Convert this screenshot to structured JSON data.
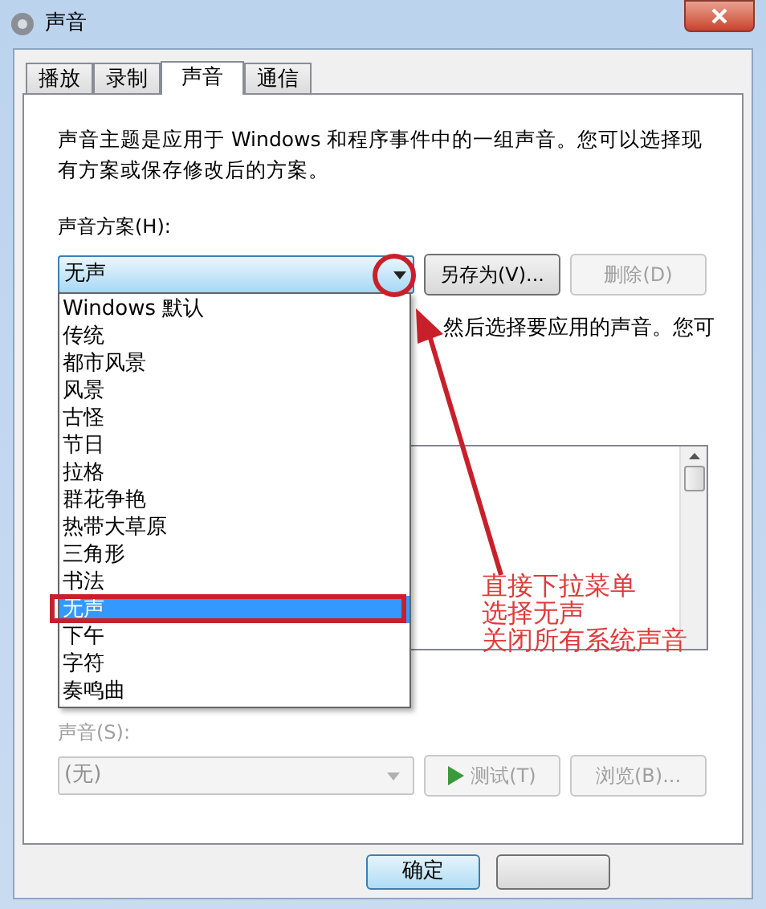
{
  "window": {
    "title": "声音"
  },
  "tabs": [
    {
      "label": "播放",
      "selected": false
    },
    {
      "label": "录制",
      "selected": false
    },
    {
      "label": "声音",
      "selected": true
    },
    {
      "label": "通信",
      "selected": false
    }
  ],
  "description": "声音主题是应用于 Windows 和程序事件中的一组声音。您可以选择现有方案或保存修改后的方案。",
  "scheme": {
    "label": "声音方案(H):",
    "value": "无声",
    "expanded": true,
    "options": [
      {
        "label": "Windows 默认",
        "selected": false
      },
      {
        "label": "传统",
        "selected": false
      },
      {
        "label": "都市风景",
        "selected": false
      },
      {
        "label": "风景",
        "selected": false
      },
      {
        "label": "古怪",
        "selected": false
      },
      {
        "label": "节日",
        "selected": false
      },
      {
        "label": "拉格",
        "selected": false
      },
      {
        "label": "群花争艳",
        "selected": false
      },
      {
        "label": "热带大草原",
        "selected": false
      },
      {
        "label": "三角形",
        "selected": false
      },
      {
        "label": "书法",
        "selected": false
      },
      {
        "label": "无声",
        "selected": true
      },
      {
        "label": "下午",
        "selected": false
      },
      {
        "label": "字符",
        "selected": false
      },
      {
        "label": "奏鸣曲",
        "selected": false
      }
    ]
  },
  "scheme_buttons": [
    {
      "label": "另存为(V)...",
      "disabled": false
    },
    {
      "label": "删除(D)",
      "disabled": true
    }
  ],
  "instruction_fragment": "然后选择要应用的声音。您可",
  "sound": {
    "label": "声音(S):",
    "value": "(无)",
    "disabled": true
  },
  "sound_buttons": [
    {
      "label": "测试(T)",
      "kind": "play",
      "disabled": true
    },
    {
      "label": "浏览(B)...",
      "kind": "plain",
      "disabled": true
    }
  ],
  "footer": {
    "ok": "确定"
  },
  "annotation": {
    "lines": [
      "直接下拉菜单",
      "选择无声",
      "关闭所有系统声音"
    ]
  }
}
